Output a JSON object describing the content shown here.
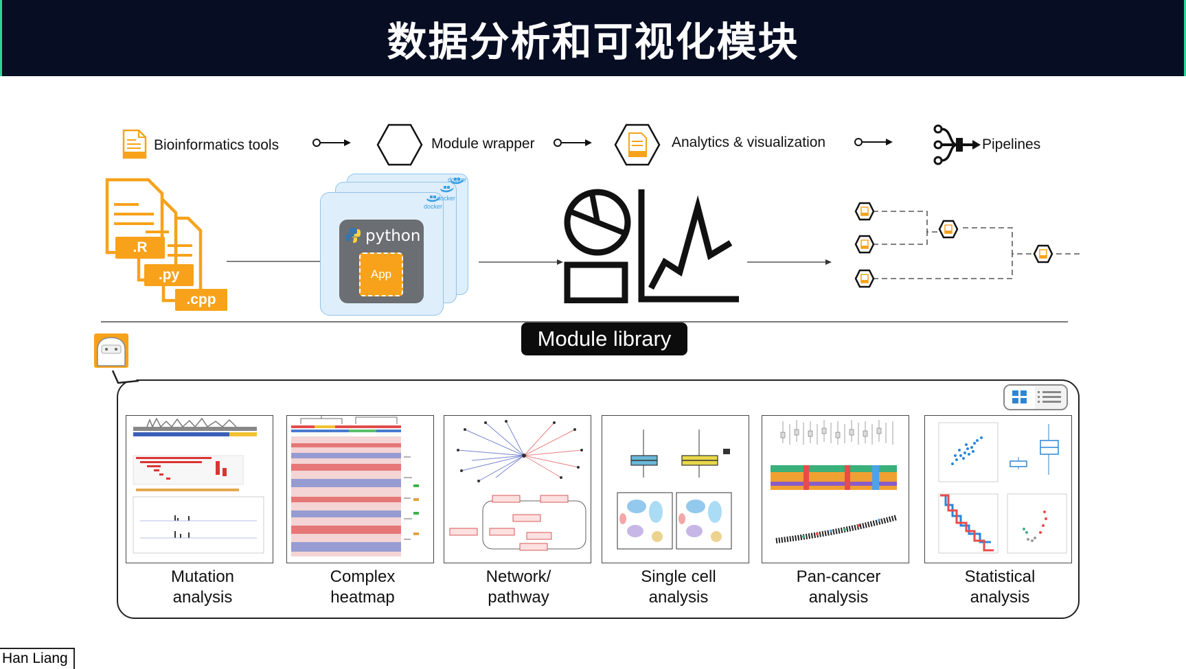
{
  "slide": {
    "title": "数据分析和可视化模块"
  },
  "workflow": {
    "steps": [
      {
        "label": "Bioinformatics tools",
        "icon": "document-icon"
      },
      {
        "label": "Module wrapper",
        "icon": "hexagon-icon"
      },
      {
        "label": "Analytics & visualization",
        "icon": "hexagon-document-icon"
      },
      {
        "label": "Pipelines",
        "icon": "pipeline-icon"
      }
    ],
    "files": [
      ".R",
      ".py",
      ".cpp"
    ],
    "container": {
      "runtime": "python",
      "app_label": "App",
      "docker_labels": [
        "docker",
        "docker",
        "docker"
      ]
    }
  },
  "module_library": {
    "label": "Module library"
  },
  "gallery": {
    "items": [
      {
        "caption_line1": "Mutation",
        "caption_line2": "analysis"
      },
      {
        "caption_line1": "Complex",
        "caption_line2": "heatmap"
      },
      {
        "caption_line1": "Network/",
        "caption_line2": "pathway"
      },
      {
        "caption_line1": "Single cell",
        "caption_line2": "analysis"
      },
      {
        "caption_line1": "Pan-cancer",
        "caption_line2": "analysis"
      },
      {
        "caption_line1": "Statistical",
        "caption_line2": "analysis"
      }
    ],
    "view_toggle": {
      "active": "grid",
      "options": [
        "grid",
        "list"
      ]
    }
  },
  "presenter": {
    "name": "Han Liang"
  },
  "colors": {
    "title_bar": "#070d22",
    "accent_orange": "#f7a21a",
    "accent_green": "#2bd49a",
    "docker_blue": "#3aa0e6",
    "grid_blue": "#2b86d6"
  }
}
